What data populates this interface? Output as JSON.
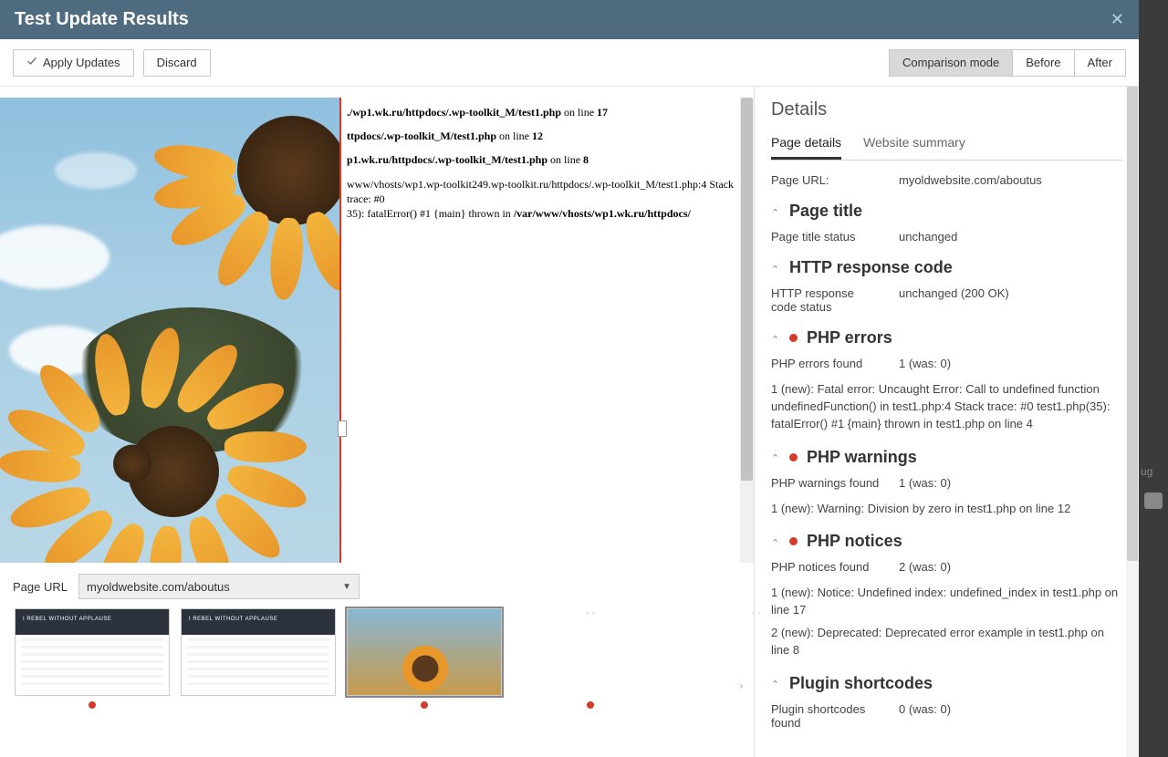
{
  "header": {
    "title": "Test Update Results"
  },
  "actions": {
    "apply": "Apply Updates",
    "discard": "Discard",
    "seg": {
      "comparison": "Comparison mode",
      "before": "Before",
      "after": "After"
    }
  },
  "preview": {
    "error_lines": [
      {
        "pre": "./wp1.wk.ru/httpdocs/.wp-toolkit_M/test1.php",
        "mid": " on line ",
        "num": "17"
      },
      {
        "pre": "ttpdocs/.wp-toolkit_M/test1.php",
        "mid": " on line ",
        "num": "12"
      },
      {
        "pre": "p1.wk.ru/httpdocs/.wp-toolkit_M/test1.php",
        "mid": " on line ",
        "num": "8"
      }
    ],
    "trace": {
      "a": "www/vhosts/wp1.wp-toolkit249.wp-toolkit.ru/httpdocs/.wp-toolkit_M/test1.php:4 Stack trace: #0",
      "b": "35): fatalError() #1 {main} thrown in ",
      "c": "/var/www/vhosts/wp1.wk.ru/httpdocs/"
    }
  },
  "page_url": {
    "label": "Page URL",
    "value": "myoldwebsite.com/aboutus"
  },
  "details": {
    "heading": "Details",
    "tabs": {
      "page": "Page details",
      "site": "Website summary"
    },
    "page_url_row": {
      "k": "Page URL:",
      "v": "myoldwebsite.com/aboutus"
    },
    "sections": {
      "page_title": {
        "title": "Page title",
        "rows": [
          {
            "k": "Page title status",
            "v": "unchanged"
          }
        ]
      },
      "http": {
        "title": "HTTP response code",
        "rows": [
          {
            "k": "HTTP response code status",
            "v": "unchanged (200 OK)"
          }
        ]
      },
      "php_errors": {
        "title": "PHP errors",
        "dot": true,
        "rows": [
          {
            "k": "PHP errors found",
            "v": "1 (was: 0)"
          }
        ],
        "msgs": [
          "1 (new): Fatal error: Uncaught Error: Call to undefined function undefinedFunction() in test1.php:4 Stack trace: #0 test1.php(35): fatalError() #1 {main} thrown in test1.php on line 4"
        ]
      },
      "php_warnings": {
        "title": "PHP warnings",
        "dot": true,
        "rows": [
          {
            "k": "PHP warnings found",
            "v": "1 (was: 0)"
          }
        ],
        "msgs": [
          "1 (new): Warning: Division by zero in test1.php on line 12"
        ]
      },
      "php_notices": {
        "title": "PHP notices",
        "dot": true,
        "rows": [
          {
            "k": "PHP notices found",
            "v": "2 (was: 0)"
          }
        ],
        "msgs": [
          "1 (new): Notice: Undefined index: undefined_index in test1.php on line 17",
          "2 (new): Deprecated: Deprecated error example in test1.php on line 8"
        ]
      },
      "shortcodes": {
        "title": "Plugin shortcodes",
        "rows": [
          {
            "k": "Plugin shortcodes found",
            "v": "0 (was: 0)"
          }
        ]
      }
    }
  }
}
